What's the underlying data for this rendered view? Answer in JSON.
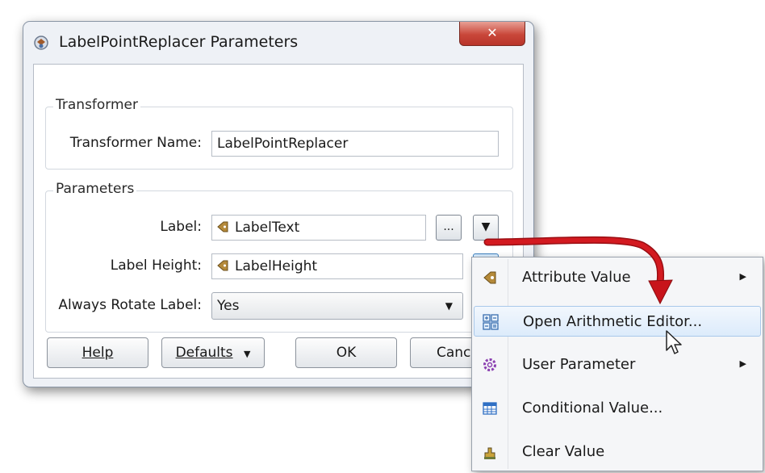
{
  "window": {
    "title": "LabelPointReplacer Parameters",
    "close_glyph": "✕"
  },
  "transformer_group": {
    "heading": "Transformer",
    "name_label": "Transformer Name:",
    "name_value": "LabelPointReplacer"
  },
  "parameters_group": {
    "heading": "Parameters",
    "label_label": "Label:",
    "label_value": "LabelText",
    "label_browse": "...",
    "height_label": "Label Height:",
    "height_value": "LabelHeight",
    "rotate_label": "Always Rotate Label:",
    "rotate_value": "Yes"
  },
  "buttons": {
    "help": "Help",
    "defaults": "Defaults",
    "ok": "OK",
    "cancel": "Canc"
  },
  "menu": {
    "items": [
      {
        "label": "Attribute Value",
        "icon": "attribute-icon",
        "submenu": true
      },
      {
        "label": "Open Arithmetic Editor...",
        "icon": "arithmetic-icon",
        "submenu": false
      },
      {
        "label": "User Parameter",
        "icon": "gear-icon",
        "submenu": true
      },
      {
        "label": "Conditional Value...",
        "icon": "table-icon",
        "submenu": false
      },
      {
        "label": "Clear Value",
        "icon": "eraser-icon",
        "submenu": false
      }
    ]
  },
  "colors": {
    "accent_arrow": "#c8141b",
    "menu_highlight": "#dcebfb"
  }
}
